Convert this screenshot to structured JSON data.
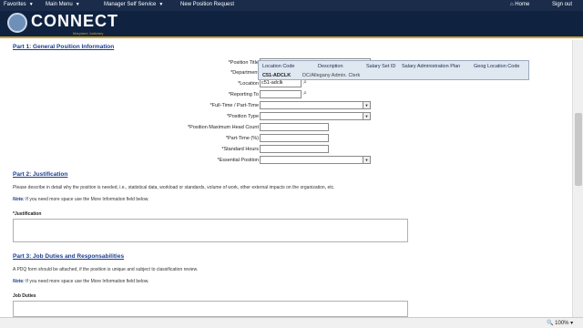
{
  "nav": {
    "favorites": "Favorites",
    "main_menu": "Main Menu",
    "manager_self_service": "Manager Self Service",
    "new_position_request": "New Position Request",
    "home": "Home",
    "sign_out": "Sign out"
  },
  "brand": {
    "name": "CONNECT",
    "sub": "Maryland Judiciary"
  },
  "part1": {
    "title": "Part 1: General Position Information",
    "labels": {
      "position_title": "*Position Title",
      "department": "*Department",
      "location": "*Location",
      "reporting_to": "*Reporting To",
      "full_part_time": "*Full-Time / Part-Time",
      "position_type": "*Position Type",
      "max_head_count": "*Position Maximum Head Count",
      "part_time_pct": "*Part-Time (%)",
      "standard_hours": "*Standard Hours",
      "essential_position": "*Essential Position"
    },
    "values": {
      "location": "c51-adclk"
    }
  },
  "lookup_popup": {
    "headers": [
      "Location Code",
      "Description",
      "Salary Set ID",
      "Salary Administration Plan",
      "Geog Location Code"
    ],
    "row": {
      "code": "C51-ADCLK",
      "description": "DC/Allegany Admin. Clerk"
    }
  },
  "part2": {
    "title": "Part 2: Justification",
    "desc": "Please describe in detail why the position is needed, i.e., statistical data, workload or standards, volume of work, other external impacts on the organization, etc.",
    "note_label": "Note:",
    "note_text": " If you need more space use the More Information field below.",
    "field_label": "*Justification"
  },
  "part3": {
    "title": "Part 3: Job Duties and Responsabilities",
    "desc": "A PDQ form should be attached, if the position is unique and subject to classification review.",
    "note_label": "Note:",
    "note_text": " If you need more space use the More Information field below.",
    "field_label": "Job Duties"
  },
  "status": {
    "zoom": "100%"
  }
}
